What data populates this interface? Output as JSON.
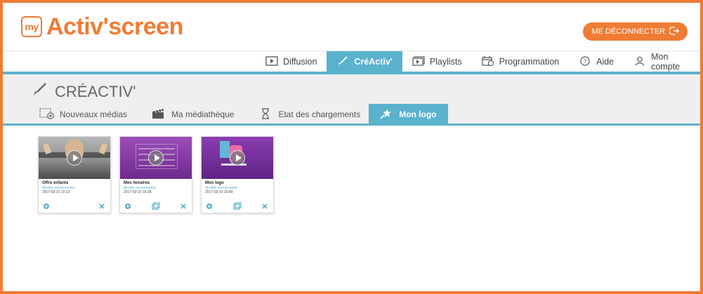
{
  "app": {
    "logo_prefix": "my",
    "logo_text": "Activ'screen"
  },
  "header": {
    "logout_label": "ME DÉCONNECTER"
  },
  "topnav": {
    "items": [
      {
        "label": "Diffusion",
        "icon": "play-icon",
        "active": false
      },
      {
        "label": "CréActiv'",
        "icon": "brush-icon",
        "active": true
      },
      {
        "label": "Playlists",
        "icon": "playlist-icon",
        "active": false
      },
      {
        "label": "Programmation",
        "icon": "calendar-icon",
        "active": false
      },
      {
        "label": "Aide",
        "icon": "help-icon",
        "active": false
      },
      {
        "label": "Mon compte",
        "icon": "user-icon",
        "active": false
      }
    ]
  },
  "section": {
    "title": "CRÉACTIV'"
  },
  "subtabs": {
    "items": [
      {
        "label": "Nouveaux médias",
        "icon": "new-media-icon",
        "active": false
      },
      {
        "label": "Ma médiathèque",
        "icon": "clapperboard-icon",
        "active": false
      },
      {
        "label": "Etat des chargements",
        "icon": "hourglass-icon",
        "active": false
      },
      {
        "label": "Mon logo",
        "icon": "star-icon",
        "active": true
      }
    ]
  },
  "cards": [
    {
      "title": "Offre enfants",
      "subtitle": "Modèle personnalisé",
      "date": "2017-03-31  15:12",
      "thumb_color": "#8a8a8a"
    },
    {
      "title": "Mes horaires",
      "subtitle": "Modèle personnalisé",
      "date": "2017-03-31  16:28",
      "thumb_color": "#8a3aa6"
    },
    {
      "title": "Mon logo",
      "subtitle": "Modèle personnalisé",
      "date": "2017-03-31  16:49",
      "thumb_color": "#7b32a0"
    }
  ],
  "colors": {
    "accent": "#ef7c34",
    "nav": "#5bb2cc",
    "section_bg": "#efefef"
  }
}
